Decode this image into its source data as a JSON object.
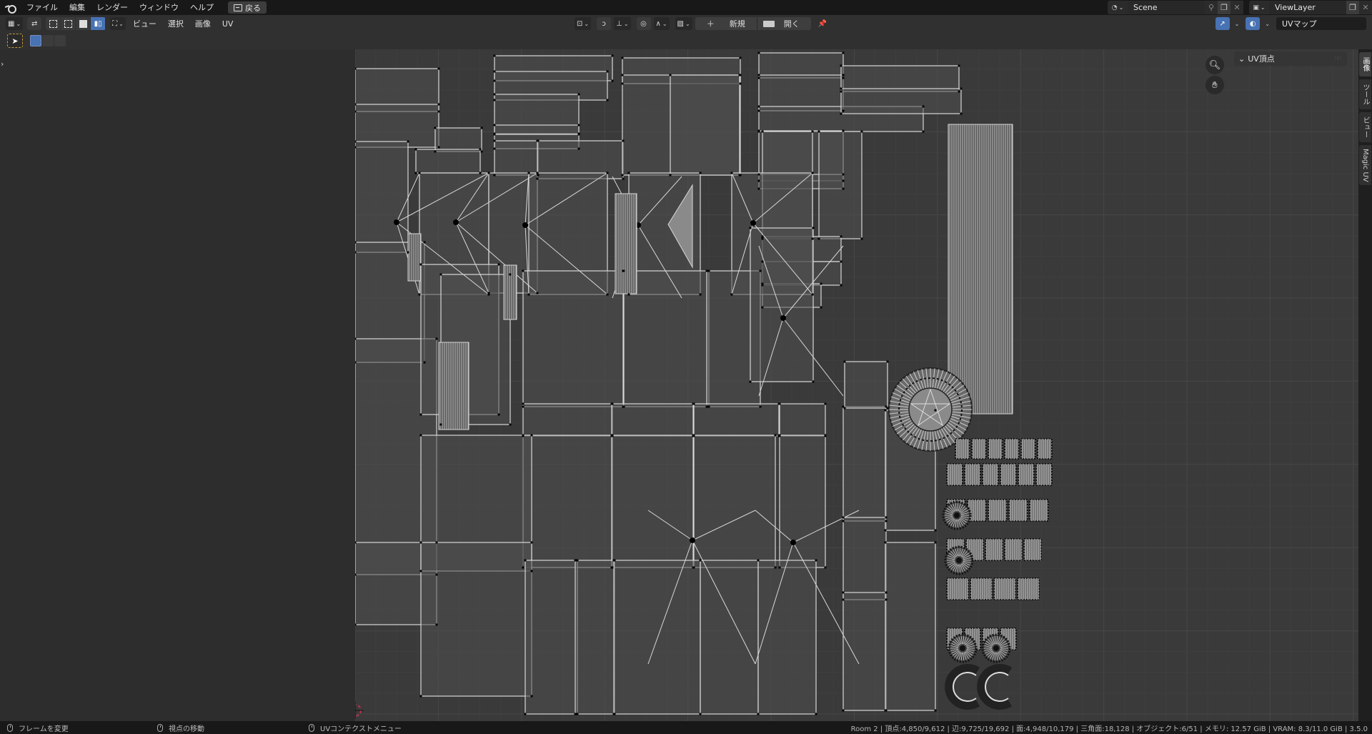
{
  "topbar": {
    "menus": [
      "ファイル",
      "編集",
      "レンダー",
      "ウィンドウ",
      "ヘルプ"
    ],
    "back_label": "戻る",
    "scene": {
      "name": "Scene"
    },
    "view_layer": {
      "name": "ViewLayer"
    }
  },
  "header": {
    "menus": [
      "ビュー",
      "選択",
      "画像",
      "UV"
    ],
    "new_label": "新規",
    "open_label": "開く",
    "uv_map": "UVマップ"
  },
  "sidebar": {
    "panel_title": "UV頂点",
    "tabs": [
      "画像",
      "ツール",
      "ビュー",
      "Magic UV"
    ],
    "active_tab": "画像"
  },
  "statusbar": {
    "hints": [
      {
        "icon": "mouse-left-icon",
        "label": "フレームを変更"
      },
      {
        "icon": "mouse-middle-icon",
        "label": "視点の移動"
      },
      {
        "icon": "mouse-right-icon",
        "label": "UVコンテクストメニュー"
      }
    ],
    "stats": "Room 2 | 頂点:4,850/9,612 | 辺:9,725/19,692 | 面:4,948/10,179 | 三角面:18,128 | オブジェクト:6/51 | メモリ: 12.57 GiB | VRAM: 8.3/11.0 GiB | 3.5.0"
  },
  "colors": {
    "accent": "#4772b3",
    "uv_face": "#4e4e4e",
    "uv_face_selected": "#8a8a8a",
    "uv_edge": "#d8d8d8",
    "uv_vertex": "#000000",
    "cursor": "#c0304a",
    "tool_highlight": "#c99b3b"
  }
}
